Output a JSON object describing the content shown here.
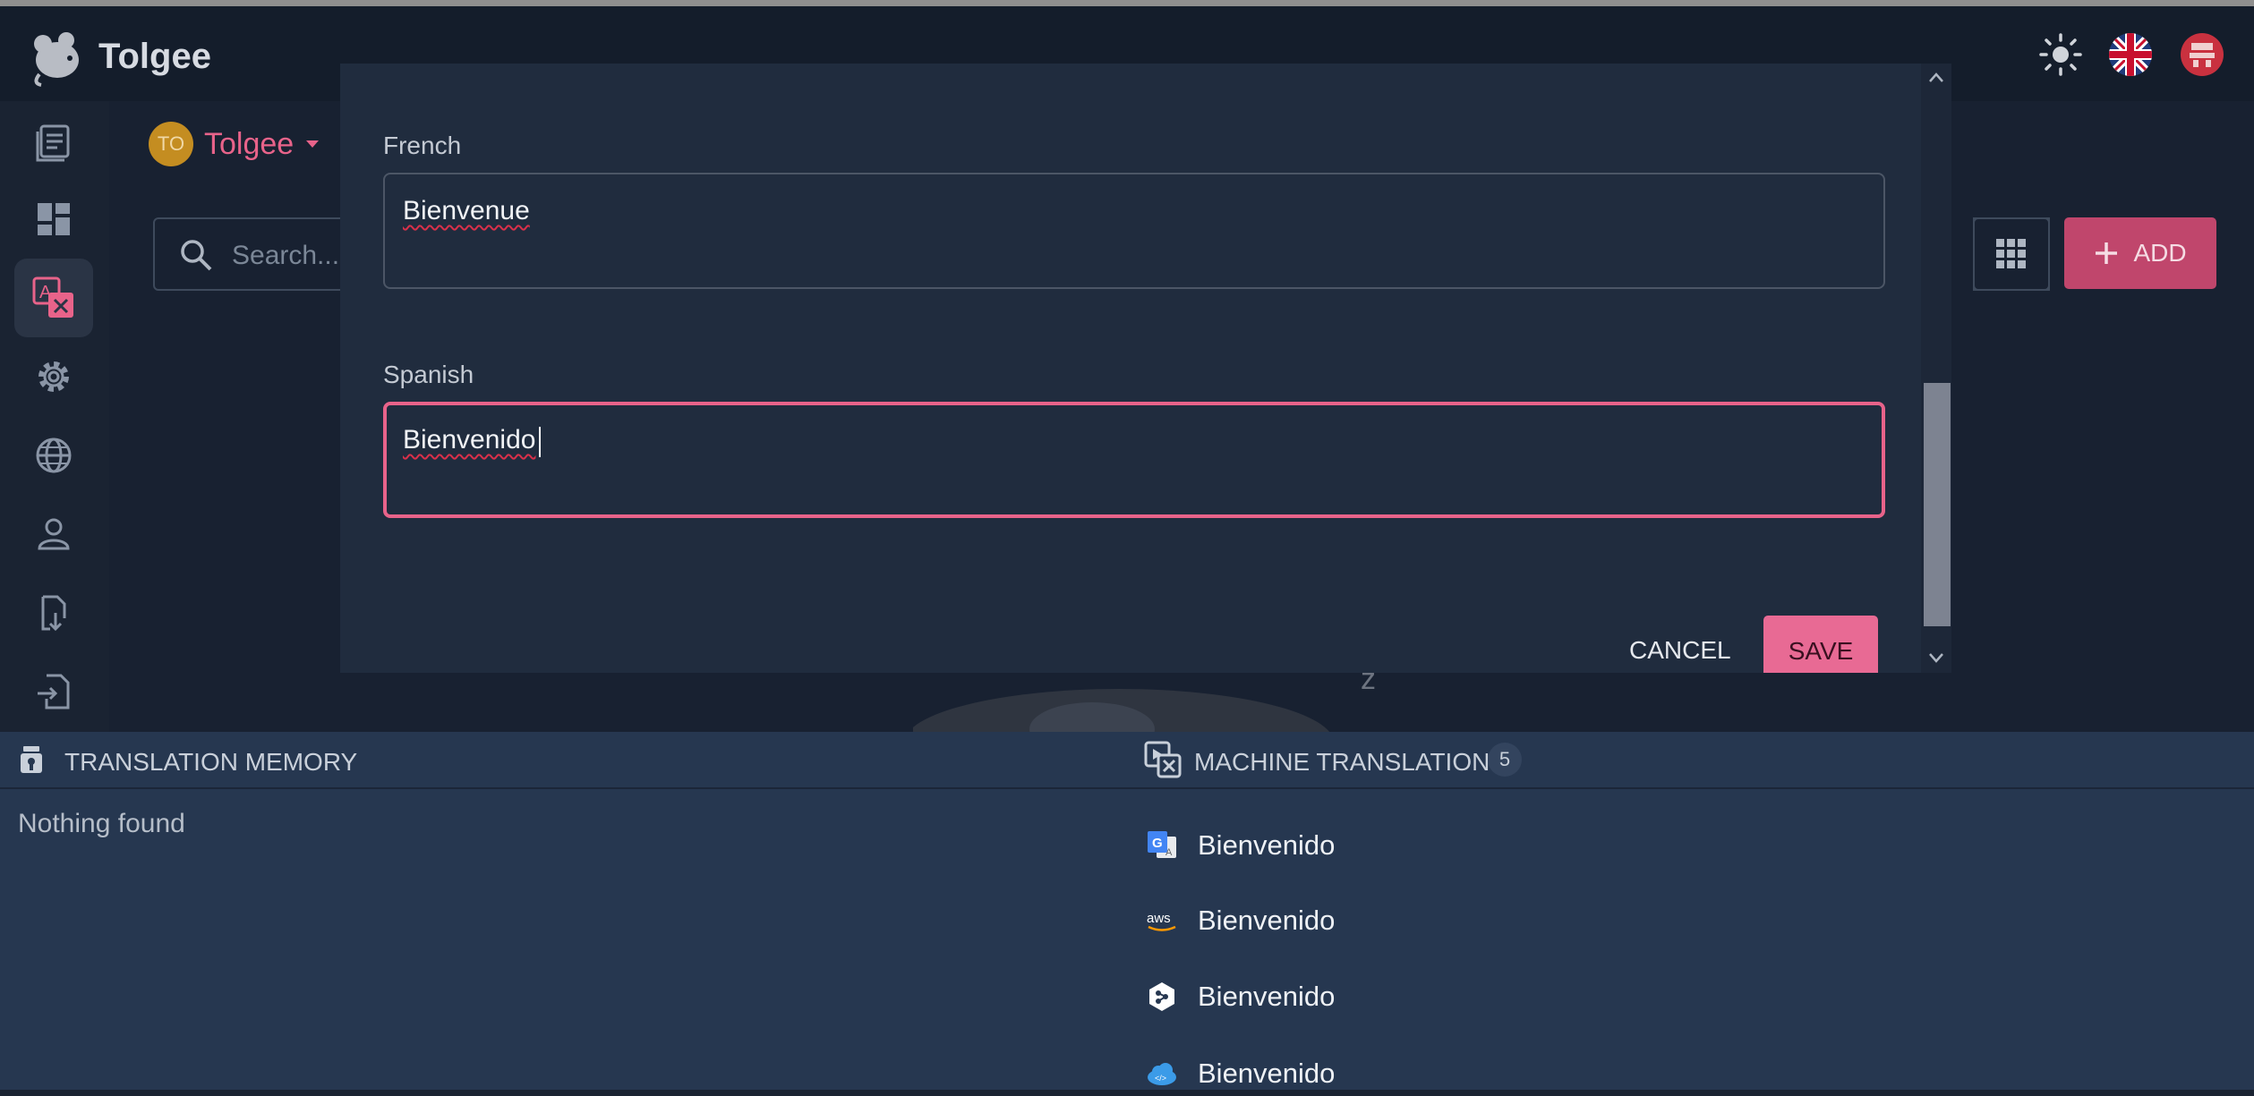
{
  "app": {
    "brand": "Tolgee"
  },
  "project": {
    "initials": "TO",
    "name": "Tolgee"
  },
  "toolbar": {
    "search_placeholder": "Search...",
    "add_label": "ADD"
  },
  "dialog": {
    "fields": [
      {
        "label": "French",
        "value": "Bienvenue"
      },
      {
        "label": "Spanish",
        "value": "Bienvenido"
      }
    ],
    "cancel_label": "CANCEL",
    "save_label": "SAVE"
  },
  "panel": {
    "tm_title": "TRANSLATION MEMORY",
    "tm_empty": "Nothing found",
    "mt_title": "MACHINE TRANSLATION",
    "mt_count": "5",
    "mt_results": [
      {
        "provider_icon": "google-translate-icon",
        "text": "Bienvenido"
      },
      {
        "provider_icon": "aws-icon",
        "text": "Bienvenido"
      },
      {
        "provider_icon": "deepl-icon",
        "text": "Bienvenido"
      },
      {
        "provider_icon": "azure-icon",
        "text": "Bienvenido"
      }
    ]
  },
  "colors": {
    "accent": "#e8638a",
    "save": "#e86a94",
    "add": "#c0466c",
    "panel": "#263750",
    "dialog": "#202c3e"
  }
}
